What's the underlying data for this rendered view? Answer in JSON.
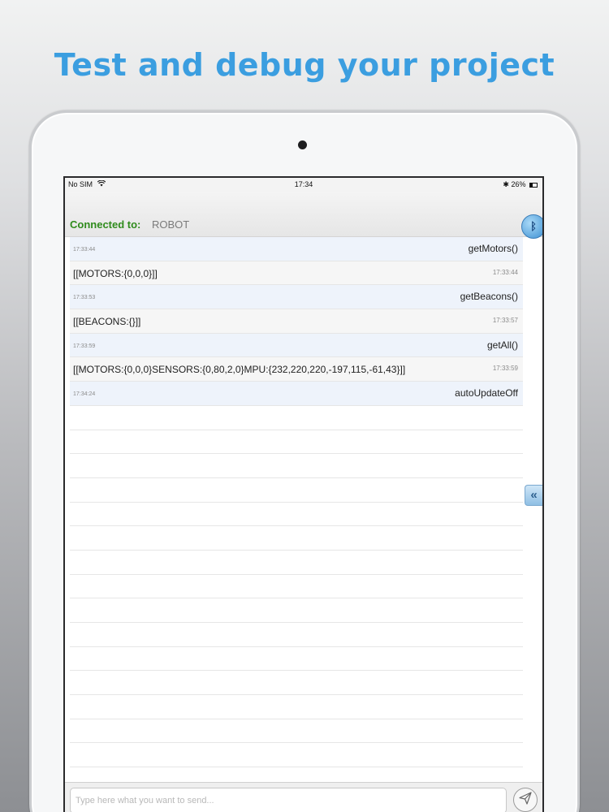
{
  "headline": "Test and debug your project",
  "status_bar": {
    "carrier": "No SIM",
    "time": "17:34",
    "battery": "26%"
  },
  "connection": {
    "label": "Connected to:",
    "device": "ROBOT"
  },
  "log": [
    {
      "type": "sent",
      "time": "17:33:44",
      "text": "getMotors()"
    },
    {
      "type": "recv",
      "time": "17:33:44",
      "text": "[[MOTORS:{0,0,0}]]"
    },
    {
      "type": "sent",
      "time": "17:33:53",
      "text": "getBeacons()"
    },
    {
      "type": "recv",
      "time": "17:33:57",
      "text": "[[BEACONS:{}]]"
    },
    {
      "type": "sent",
      "time": "17:33:59",
      "text": "getAll()"
    },
    {
      "type": "recv",
      "time": "17:33:59",
      "text": "[[MOTORS:{0,0,0}SENSORS:{0,80,2,0}MPU:{232,220,220,-197,115,-61,43}]]"
    },
    {
      "type": "sent",
      "time": "17:34:24",
      "text": "autoUpdateOff"
    }
  ],
  "composer": {
    "placeholder": "Type here what you want to send...",
    "value": ""
  },
  "icons": {
    "bluetooth": "bluetooth-icon",
    "collapse": "double-chevron-left-icon",
    "send": "paper-plane-icon",
    "wifi": "wifi-icon",
    "battery": "battery-icon"
  },
  "colors": {
    "headline": "#3b9ee0",
    "connected_label": "#2f8b1c",
    "sent_row": "#eef3fb",
    "recv_row": "#f6f6f6"
  }
}
